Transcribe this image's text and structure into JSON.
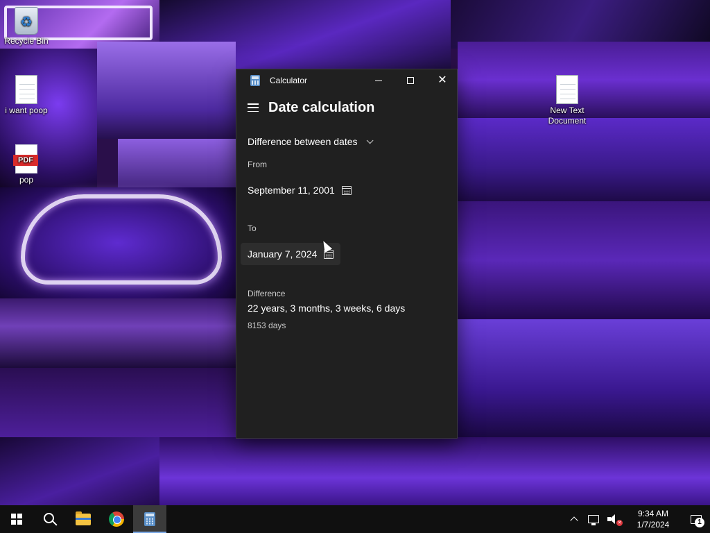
{
  "desktop": {
    "icons": [
      {
        "label": "Recycle Bin"
      },
      {
        "label": "i want poop"
      },
      {
        "label": "pop",
        "badge": "PDF"
      },
      {
        "label": "New Text Document"
      }
    ]
  },
  "window": {
    "title": "Calculator",
    "mode_title": "Date calculation",
    "calc_mode": "Difference between dates",
    "from": {
      "label": "From",
      "value": "September 11, 2001"
    },
    "to": {
      "label": "To",
      "value": "January 7, 2024"
    },
    "difference": {
      "label": "Difference",
      "value": "22 years, 3 months, 3 weeks, 6 days",
      "days": "8153 days"
    }
  },
  "taskbar": {
    "apps": [
      "start-icon",
      "search-icon",
      "file-explorer-icon",
      "chrome-icon",
      "calculator-icon"
    ],
    "active_app": "calculator",
    "clock": {
      "time": "9:34 AM",
      "date": "1/7/2024"
    },
    "notification_count": "1"
  },
  "colors": {
    "window_bg": "#202020",
    "taskbar_bg": "#101010",
    "accent": "#7aa8e6"
  }
}
